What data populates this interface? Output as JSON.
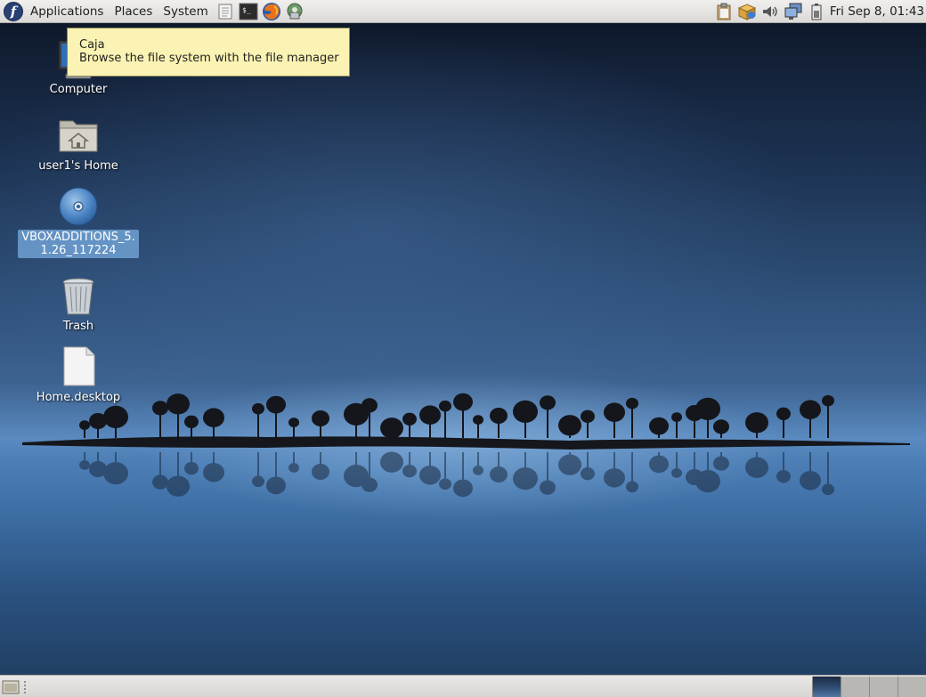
{
  "top_panel": {
    "menus": [
      {
        "label": "Applications"
      },
      {
        "label": "Places"
      },
      {
        "label": "System"
      }
    ],
    "launchers": [
      {
        "icon": "text-editor-icon"
      },
      {
        "icon": "terminal-icon"
      },
      {
        "icon": "firefox-icon"
      },
      {
        "icon": "network-tool-icon"
      }
    ],
    "tray": [
      {
        "icon": "clipboard-icon"
      },
      {
        "icon": "package-updates-icon"
      },
      {
        "icon": "volume-icon"
      },
      {
        "icon": "network-icon"
      },
      {
        "icon": "battery-icon"
      }
    ],
    "clock": "Fri Sep  8, 01:43"
  },
  "tooltip": {
    "title": "Caja",
    "description": "Browse the file system with the file manager"
  },
  "desktop_icons": [
    {
      "label": "Computer",
      "icon": "computer-icon",
      "selected": false
    },
    {
      "label": "user1's Home",
      "icon": "home-folder-icon",
      "selected": false
    },
    {
      "label": "VBOXADDITIONS_5.1.26_117224",
      "icon": "optical-disc-icon",
      "selected": true
    },
    {
      "label": "Trash",
      "icon": "trash-icon",
      "selected": false
    },
    {
      "label": "Home.desktop",
      "icon": "file-icon",
      "selected": false
    }
  ],
  "bottom_panel": {
    "workspaces": [
      {
        "active": true
      },
      {
        "active": false
      },
      {
        "active": false
      },
      {
        "active": false
      }
    ]
  },
  "colors": {
    "panel_bg": "#e3e1de",
    "tooltip_bg": "#fbf3b3",
    "selection": "#6ea0d2",
    "fedora_blue": "#294172"
  }
}
